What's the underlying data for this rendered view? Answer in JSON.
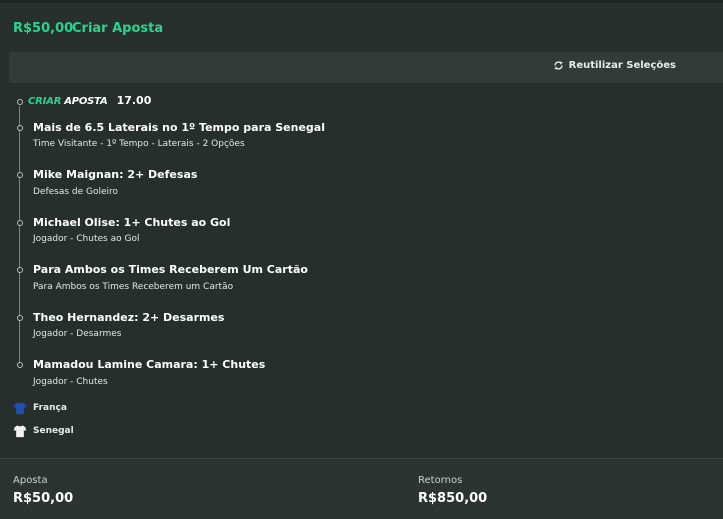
{
  "header": {
    "amount": "R$50,00",
    "title": "Criar Aposta"
  },
  "reuse": {
    "label": "Reutilizar Seleções",
    "icon": "refresh-icon"
  },
  "criar_aposta": {
    "logo_criar": "CRIAR",
    "logo_aposta": "APOSTA",
    "odds": "17.00"
  },
  "selections": [
    {
      "title": "Mais de 6.5 Laterais no 1º Tempo para Senegal",
      "subtitle": "Time Visitante - 1º Tempo - Laterais - 2 Opções"
    },
    {
      "title": "Mike Maignan: 2+ Defesas",
      "subtitle": "Defesas de Goleiro"
    },
    {
      "title": "Michael Olise: 1+ Chutes ao Gol",
      "subtitle": "Jogador - Chutes ao Gol"
    },
    {
      "title": "Para Ambos os Times Receberem Um Cartão",
      "subtitle": "Para Ambos os Times Receberem um Cartão"
    },
    {
      "title": "Theo Hernandez: 2+ Desarmes",
      "subtitle": "Jogador - Desarmes"
    },
    {
      "title": "Mamadou Lamine Camara: 1+ Chutes",
      "subtitle": "Jogador - Chutes"
    }
  ],
  "teams": [
    {
      "name": "França",
      "icon": "shirt-icon",
      "color": "#1e4fb4"
    },
    {
      "name": "Senegal",
      "icon": "shirt-icon",
      "color": "#f2f2f2"
    }
  ],
  "footer": {
    "stake_label": "Aposta",
    "stake_value": "R$50,00",
    "returns_label": "Retornos",
    "returns_value": "R$850,00"
  },
  "colors": {
    "accent": "#2ad38f",
    "background": "#262f2c"
  }
}
